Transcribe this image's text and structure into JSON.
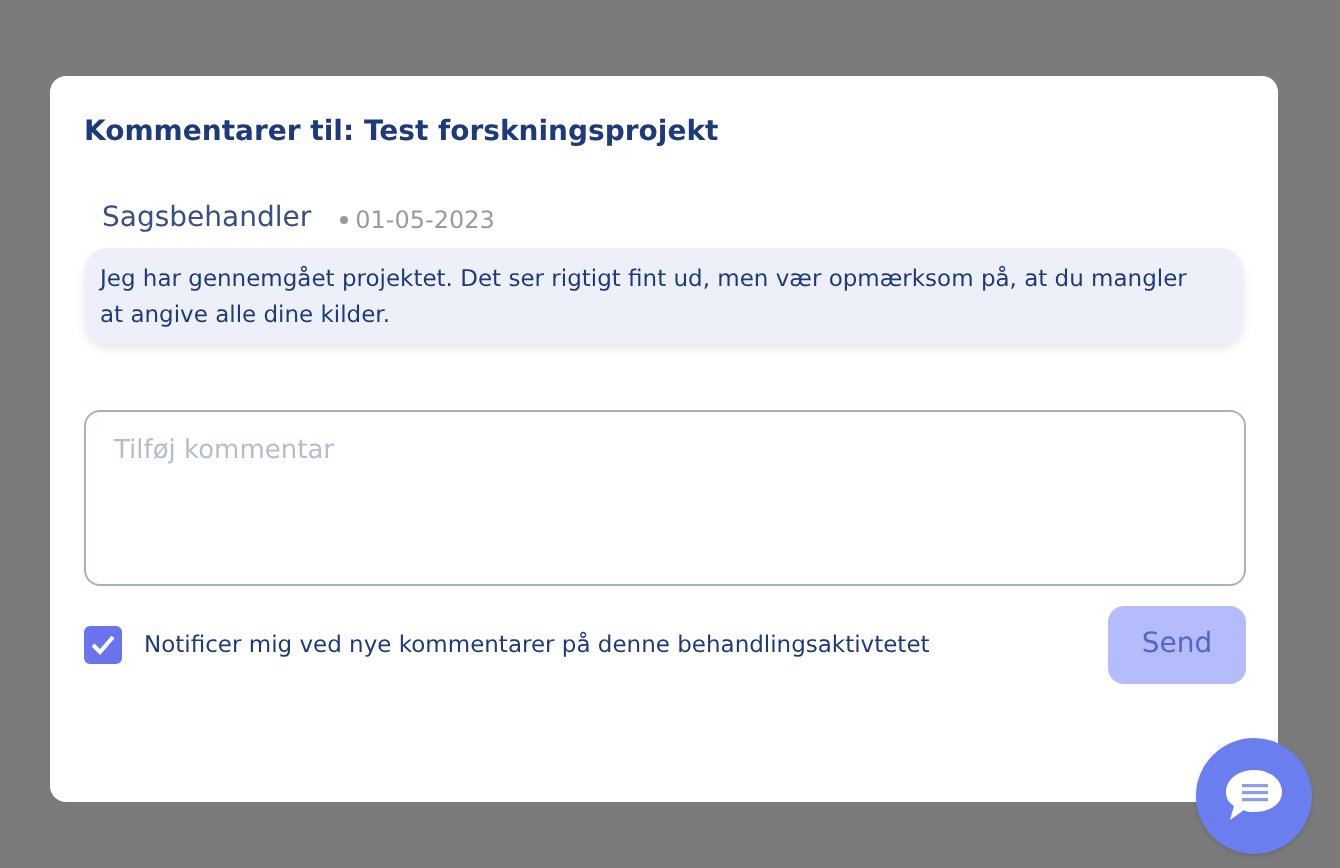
{
  "dialog": {
    "title": "Kommentarer til: Test forskningsprojekt"
  },
  "comments": [
    {
      "author": "Sagsbehandler",
      "date": "01-05-2023",
      "text": "Jeg har gennemgået projektet. Det ser rigtigt fint ud, men vær opmærksom på, at du mangler at angive alle dine kilder."
    }
  ],
  "comment_field": {
    "placeholder": "Tilføj kommentar"
  },
  "notify_checkbox": {
    "label": "Notificer mig ved nye kommentarer på denne behandlingsaktivtetet",
    "checked": true
  },
  "send_button": {
    "label": "Send",
    "disabled": true
  }
}
